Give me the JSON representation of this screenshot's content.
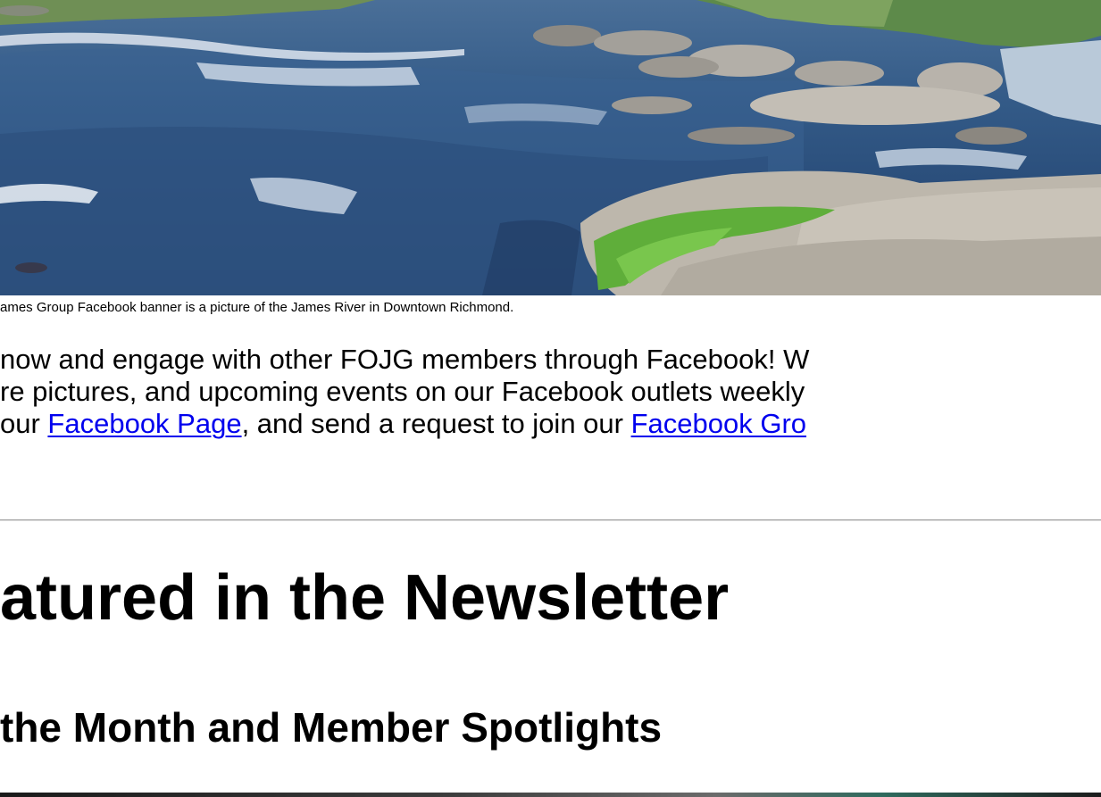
{
  "banner": {
    "alt_icon": "river-photo-icon"
  },
  "caption": "ames Group Facebook banner is a picture of the James River in Downtown Richmond.",
  "paragraph": {
    "line1": "now and engage with other FOJG members through Facebook! W",
    "line2": "re pictures, and upcoming events on our Facebook outlets weekly",
    "line3_prefix": "our ",
    "link1": "Facebook Page",
    "line3_middle": ", and send a request to join our ",
    "link2": "Facebook Gro"
  },
  "headings": {
    "featured": "atured in the Newsletter",
    "spotlights": "the Month and Member Spotlights"
  },
  "colors": {
    "link": "#0000ee",
    "text": "#000000",
    "rule": "#9a9a9a"
  }
}
